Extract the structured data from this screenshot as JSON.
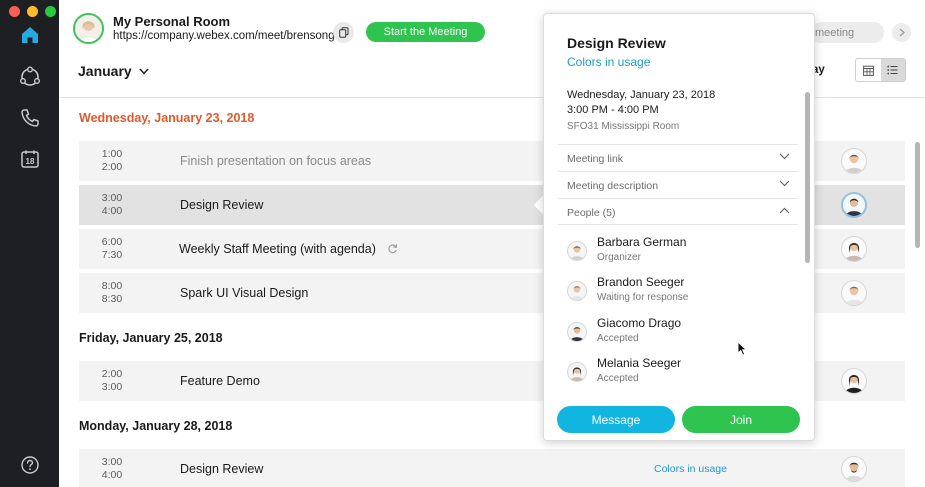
{
  "window": {
    "controls": [
      "close",
      "minimize",
      "zoom"
    ]
  },
  "sidebar": {
    "items": [
      {
        "icon": "home-icon",
        "active": true
      },
      {
        "icon": "teams-icon"
      },
      {
        "icon": "phone-icon"
      },
      {
        "icon": "calendar-icon",
        "label": "18"
      },
      {
        "icon": "help-icon"
      }
    ]
  },
  "header": {
    "room_title": "My Personal Room",
    "room_url": "https://company.webex.com/meet/brensong",
    "start_button": "Start the Meeting",
    "month": "January",
    "meeting_pill": "meeting",
    "today_label": "ay"
  },
  "agenda": {
    "days": [
      {
        "label": "Wednesday, January 23, 2018",
        "today": true,
        "events": [
          {
            "start": "1:00",
            "end": "2:00",
            "title": "Finish presentation on focus areas",
            "past": true
          },
          {
            "start": "3:00",
            "end": "4:00",
            "title": "Design Review",
            "selected": true
          },
          {
            "start": "6:00",
            "end": "7:30",
            "title": "Weekly Staff Meeting (with agenda)",
            "recurring": true
          },
          {
            "start": "8:00",
            "end": "8:30",
            "title": "Spark UI Visual Design"
          }
        ]
      },
      {
        "label": "Friday, January 25, 2018",
        "events": [
          {
            "start": "2:00",
            "end": "3:00",
            "title": "Feature Demo"
          }
        ]
      },
      {
        "label": "Monday, January 28, 2018",
        "events": [
          {
            "start": "3:00",
            "end": "4:00",
            "title": "Design Review",
            "link": "Colors in usage"
          }
        ]
      }
    ]
  },
  "popup": {
    "title": "Design Review",
    "subtitle": "Colors in usage",
    "date": "Wednesday, January 23, 2018",
    "time": "3:00 PM - 4:00 PM",
    "room": "SFO31 Mississippi Room",
    "sections": {
      "meeting_link": "Meeting link",
      "meeting_description": "Meeting description",
      "people": "People (5)"
    },
    "people": [
      {
        "name": "Barbara German",
        "status": "Organizer"
      },
      {
        "name": "Brandon Seeger",
        "status": "Waiting for response"
      },
      {
        "name": "Giacomo Drago",
        "status": "Accepted"
      },
      {
        "name": "Melania Seeger",
        "status": "Accepted"
      }
    ],
    "message_button": "Message",
    "join_button": "Join"
  },
  "colors": {
    "accent_green": "#2fc44f",
    "accent_blue": "#11b5e0",
    "today_orange": "#e05a2b",
    "link_blue": "#1d9bc8"
  }
}
